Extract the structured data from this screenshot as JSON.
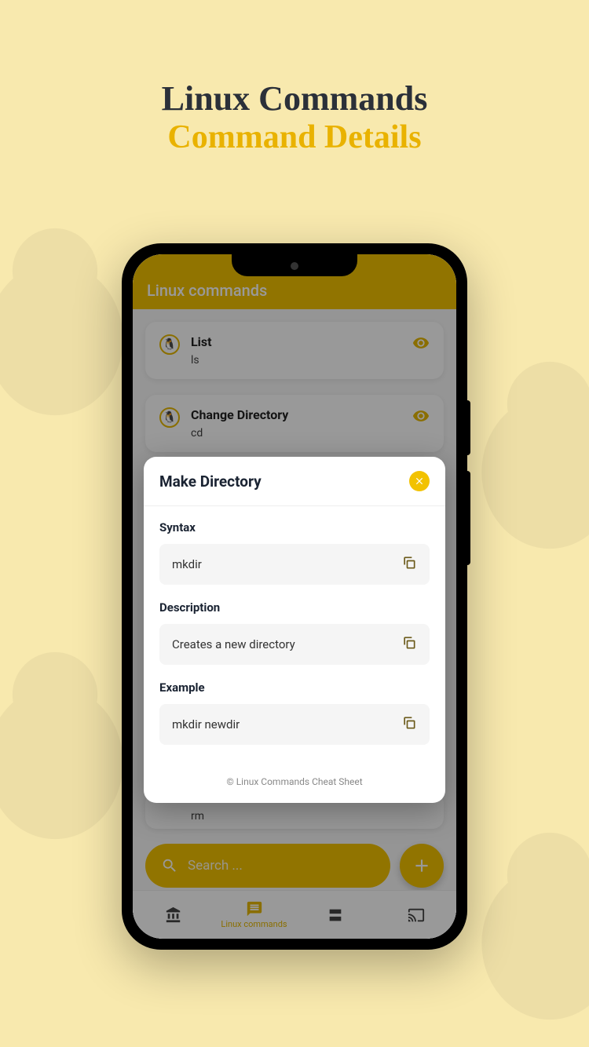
{
  "heading": {
    "line1": "Linux Commands",
    "line2": "Command Details"
  },
  "app": {
    "header_title": "Linux commands",
    "cards": [
      {
        "title": "List",
        "sub": "ls"
      },
      {
        "title": "Change Directory",
        "sub": "cd"
      }
    ],
    "partial_card_sub": "rm",
    "search_placeholder": "Search ...",
    "nav": {
      "active_label": "Linux commands"
    }
  },
  "modal": {
    "title": "Make Directory",
    "sections": [
      {
        "label": "Syntax",
        "value": "mkdir"
      },
      {
        "label": "Description",
        "value": "Creates a new directory"
      },
      {
        "label": "Example",
        "value": "mkdir newdir"
      }
    ],
    "footer": "© Linux Commands Cheat Sheet"
  }
}
